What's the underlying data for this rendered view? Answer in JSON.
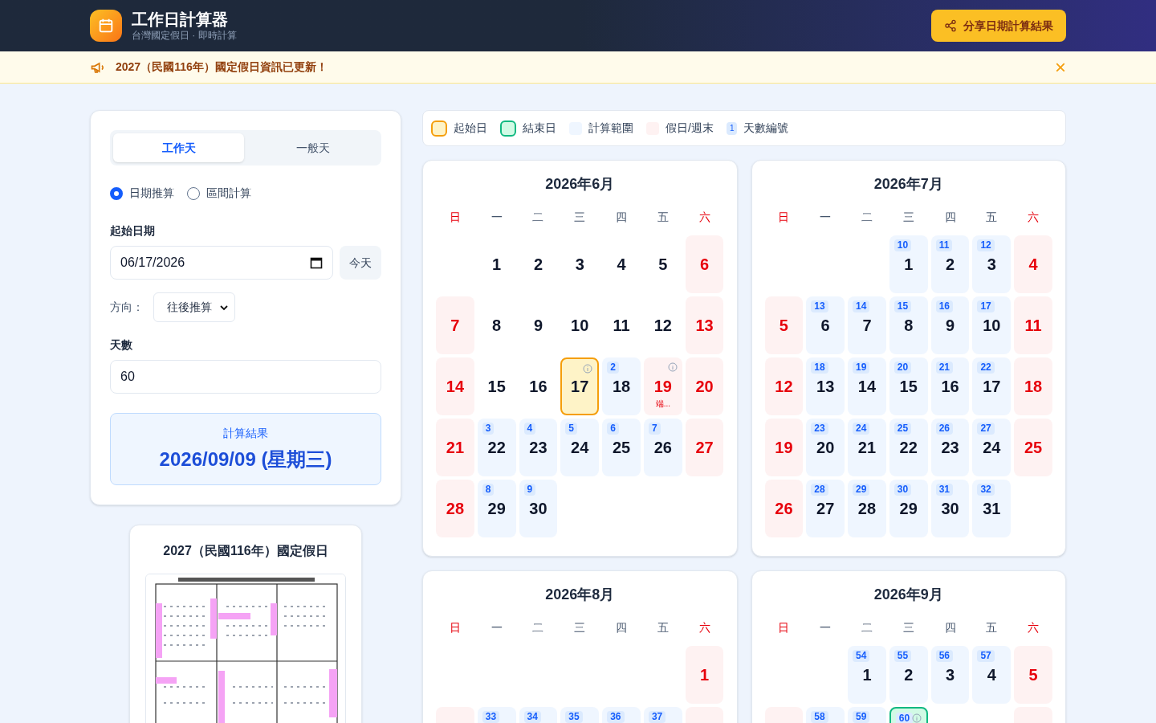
{
  "header": {
    "title": "工作日計算器",
    "subtitle": "台灣國定假日 · 即時計算",
    "share_button": "分享日期計算結果"
  },
  "banner": {
    "text": "2027（民國116年）國定假日資訊已更新！",
    "close": "×"
  },
  "calculator": {
    "tabs": [
      {
        "label": "工作天",
        "selected": true
      },
      {
        "label": "一般天",
        "selected": false
      }
    ],
    "modes": [
      {
        "label": "日期推算",
        "checked": true
      },
      {
        "label": "區間計算",
        "checked": false
      }
    ],
    "start_label": "起始日期",
    "start_value": "06/17/2026",
    "today_button": "今天",
    "direction_label": "方向：",
    "direction_value": "往後推算",
    "days_label": "天數",
    "days_value": "60",
    "result_label": "計算結果",
    "result_value": "2026/09/09 (星期三)"
  },
  "holiday_card": {
    "title": "2027（民國116年）國定假日"
  },
  "legend": [
    {
      "kind": "start",
      "label": "起始日"
    },
    {
      "kind": "end",
      "label": "結束日"
    },
    {
      "kind": "range",
      "label": "計算範圍"
    },
    {
      "kind": "holiday",
      "label": "假日/週末"
    },
    {
      "kind": "count",
      "badge": "1",
      "label": "天數編號"
    }
  ],
  "months": [
    {
      "title": "2026年6月",
      "weekdays": [
        {
          "label": "日",
          "weekend": true
        },
        {
          "label": "一",
          "weekend": false
        },
        {
          "label": "二",
          "weekend": false
        },
        {
          "label": "三",
          "weekend": false
        },
        {
          "label": "四",
          "weekend": false
        },
        {
          "label": "五",
          "weekend": false
        },
        {
          "label": "六",
          "weekend": true
        }
      ],
      "cells": [
        {
          "kind": "empty"
        },
        {
          "kind": "plain",
          "day": "1"
        },
        {
          "kind": "plain",
          "day": "2"
        },
        {
          "kind": "plain",
          "day": "3"
        },
        {
          "kind": "plain",
          "day": "4"
        },
        {
          "kind": "plain",
          "day": "5"
        },
        {
          "kind": "holiday",
          "day": "6"
        },
        {
          "kind": "holiday",
          "day": "7"
        },
        {
          "kind": "plain",
          "day": "8"
        },
        {
          "kind": "plain",
          "day": "9"
        },
        {
          "kind": "plain",
          "day": "10"
        },
        {
          "kind": "plain",
          "day": "11"
        },
        {
          "kind": "plain",
          "day": "12"
        },
        {
          "kind": "holiday",
          "day": "13"
        },
        {
          "kind": "holiday",
          "day": "14"
        },
        {
          "kind": "plain",
          "day": "15"
        },
        {
          "kind": "plain",
          "day": "16"
        },
        {
          "kind": "start",
          "day": "17",
          "info": true
        },
        {
          "kind": "range",
          "day": "18",
          "count": "2"
        },
        {
          "kind": "holiday",
          "day": "19",
          "info": true,
          "note": "端..."
        },
        {
          "kind": "holiday",
          "day": "20"
        },
        {
          "kind": "holiday",
          "day": "21"
        },
        {
          "kind": "range",
          "day": "22",
          "count": "3"
        },
        {
          "kind": "range",
          "day": "23",
          "count": "4"
        },
        {
          "kind": "range",
          "day": "24",
          "count": "5"
        },
        {
          "kind": "range",
          "day": "25",
          "count": "6"
        },
        {
          "kind": "range",
          "day": "26",
          "count": "7"
        },
        {
          "kind": "holiday",
          "day": "27"
        },
        {
          "kind": "holiday",
          "day": "28"
        },
        {
          "kind": "range",
          "day": "29",
          "count": "8"
        },
        {
          "kind": "range",
          "day": "30",
          "count": "9"
        }
      ]
    },
    {
      "title": "2026年7月",
      "weekdays": [
        {
          "label": "日",
          "weekend": true
        },
        {
          "label": "一",
          "weekend": false
        },
        {
          "label": "二",
          "weekend": false
        },
        {
          "label": "三",
          "weekend": false
        },
        {
          "label": "四",
          "weekend": false
        },
        {
          "label": "五",
          "weekend": false
        },
        {
          "label": "六",
          "weekend": true
        }
      ],
      "cells": [
        {
          "kind": "empty"
        },
        {
          "kind": "empty"
        },
        {
          "kind": "empty"
        },
        {
          "kind": "range",
          "day": "1",
          "count": "10"
        },
        {
          "kind": "range",
          "day": "2",
          "count": "11"
        },
        {
          "kind": "range",
          "day": "3",
          "count": "12"
        },
        {
          "kind": "holiday",
          "day": "4"
        },
        {
          "kind": "holiday",
          "day": "5"
        },
        {
          "kind": "range",
          "day": "6",
          "count": "13"
        },
        {
          "kind": "range",
          "day": "7",
          "count": "14"
        },
        {
          "kind": "range",
          "day": "8",
          "count": "15"
        },
        {
          "kind": "range",
          "day": "9",
          "count": "16"
        },
        {
          "kind": "range",
          "day": "10",
          "count": "17"
        },
        {
          "kind": "holiday",
          "day": "11"
        },
        {
          "kind": "holiday",
          "day": "12"
        },
        {
          "kind": "range",
          "day": "13",
          "count": "18"
        },
        {
          "kind": "range",
          "day": "14",
          "count": "19"
        },
        {
          "kind": "range",
          "day": "15",
          "count": "20"
        },
        {
          "kind": "range",
          "day": "16",
          "count": "21"
        },
        {
          "kind": "range",
          "day": "17",
          "count": "22"
        },
        {
          "kind": "holiday",
          "day": "18"
        },
        {
          "kind": "holiday",
          "day": "19"
        },
        {
          "kind": "range",
          "day": "20",
          "count": "23"
        },
        {
          "kind": "range",
          "day": "21",
          "count": "24"
        },
        {
          "kind": "range",
          "day": "22",
          "count": "25"
        },
        {
          "kind": "range",
          "day": "23",
          "count": "26"
        },
        {
          "kind": "range",
          "day": "24",
          "count": "27"
        },
        {
          "kind": "holiday",
          "day": "25"
        },
        {
          "kind": "holiday",
          "day": "26"
        },
        {
          "kind": "range",
          "day": "27",
          "count": "28"
        },
        {
          "kind": "range",
          "day": "28",
          "count": "29"
        },
        {
          "kind": "range",
          "day": "29",
          "count": "30"
        },
        {
          "kind": "range",
          "day": "30",
          "count": "31"
        },
        {
          "kind": "range",
          "day": "31",
          "count": "32"
        }
      ]
    },
    {
      "title": "2026年8月",
      "weekdays": [
        {
          "label": "日",
          "weekend": true
        },
        {
          "label": "一",
          "weekend": false
        },
        {
          "label": "二",
          "weekend": false
        },
        {
          "label": "三",
          "weekend": false
        },
        {
          "label": "四",
          "weekend": false
        },
        {
          "label": "五",
          "weekend": false
        },
        {
          "label": "六",
          "weekend": true
        }
      ],
      "cells": [
        {
          "kind": "empty"
        },
        {
          "kind": "empty"
        },
        {
          "kind": "empty"
        },
        {
          "kind": "empty"
        },
        {
          "kind": "empty"
        },
        {
          "kind": "empty"
        },
        {
          "kind": "holiday",
          "day": "1"
        },
        {
          "kind": "holiday"
        },
        {
          "kind": "range",
          "count": "33"
        },
        {
          "kind": "range",
          "count": "34"
        },
        {
          "kind": "range",
          "count": "35"
        },
        {
          "kind": "range",
          "count": "36"
        },
        {
          "kind": "range",
          "count": "37"
        },
        {
          "kind": "holiday"
        }
      ]
    },
    {
      "title": "2026年9月",
      "weekdays": [
        {
          "label": "日",
          "weekend": true
        },
        {
          "label": "一",
          "weekend": false
        },
        {
          "label": "二",
          "weekend": false
        },
        {
          "label": "三",
          "weekend": false
        },
        {
          "label": "四",
          "weekend": false
        },
        {
          "label": "五",
          "weekend": false
        },
        {
          "label": "六",
          "weekend": true
        }
      ],
      "cells": [
        {
          "kind": "empty"
        },
        {
          "kind": "empty"
        },
        {
          "kind": "range",
          "day": "1",
          "count": "54"
        },
        {
          "kind": "range",
          "day": "2",
          "count": "55"
        },
        {
          "kind": "range",
          "day": "3",
          "count": "56"
        },
        {
          "kind": "range",
          "day": "4",
          "count": "57"
        },
        {
          "kind": "holiday",
          "day": "5"
        },
        {
          "kind": "holiday"
        },
        {
          "kind": "range",
          "count": "58"
        },
        {
          "kind": "range",
          "count": "59"
        },
        {
          "kind": "end",
          "count": "60",
          "info": true
        },
        {
          "kind": "plain"
        },
        {
          "kind": "plain"
        },
        {
          "kind": "holiday"
        }
      ]
    }
  ]
}
